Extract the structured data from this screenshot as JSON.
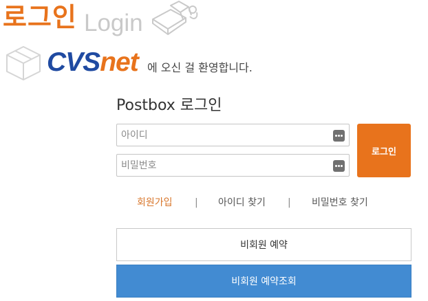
{
  "header": {
    "title_ko": "로그인",
    "title_en": "Login"
  },
  "welcome": {
    "logo_part1": "CVS",
    "logo_part2": "net",
    "message": "에 오신 걸 환영합니다."
  },
  "form": {
    "title": "Postbox 로그인",
    "id_placeholder": "아이디",
    "password_placeholder": "비밀번호",
    "login_label": "로그인"
  },
  "links": {
    "signup": "회원가입",
    "separator": "|",
    "find_id": "아이디 찾기",
    "find_password": "비밀번호 찾기"
  },
  "buttons": {
    "guest_reserve": "비회원 예약",
    "guest_lookup": "비회원 예약조회"
  },
  "colors": {
    "brand_orange": "#e8731c",
    "brand_blue": "#1f4aa1",
    "lookup_blue": "#428bd2"
  },
  "icons": {
    "header_decoration": "parcel-box-icon",
    "welcome_decoration": "box-outline-icon",
    "field_key": "keyboard-icon"
  }
}
